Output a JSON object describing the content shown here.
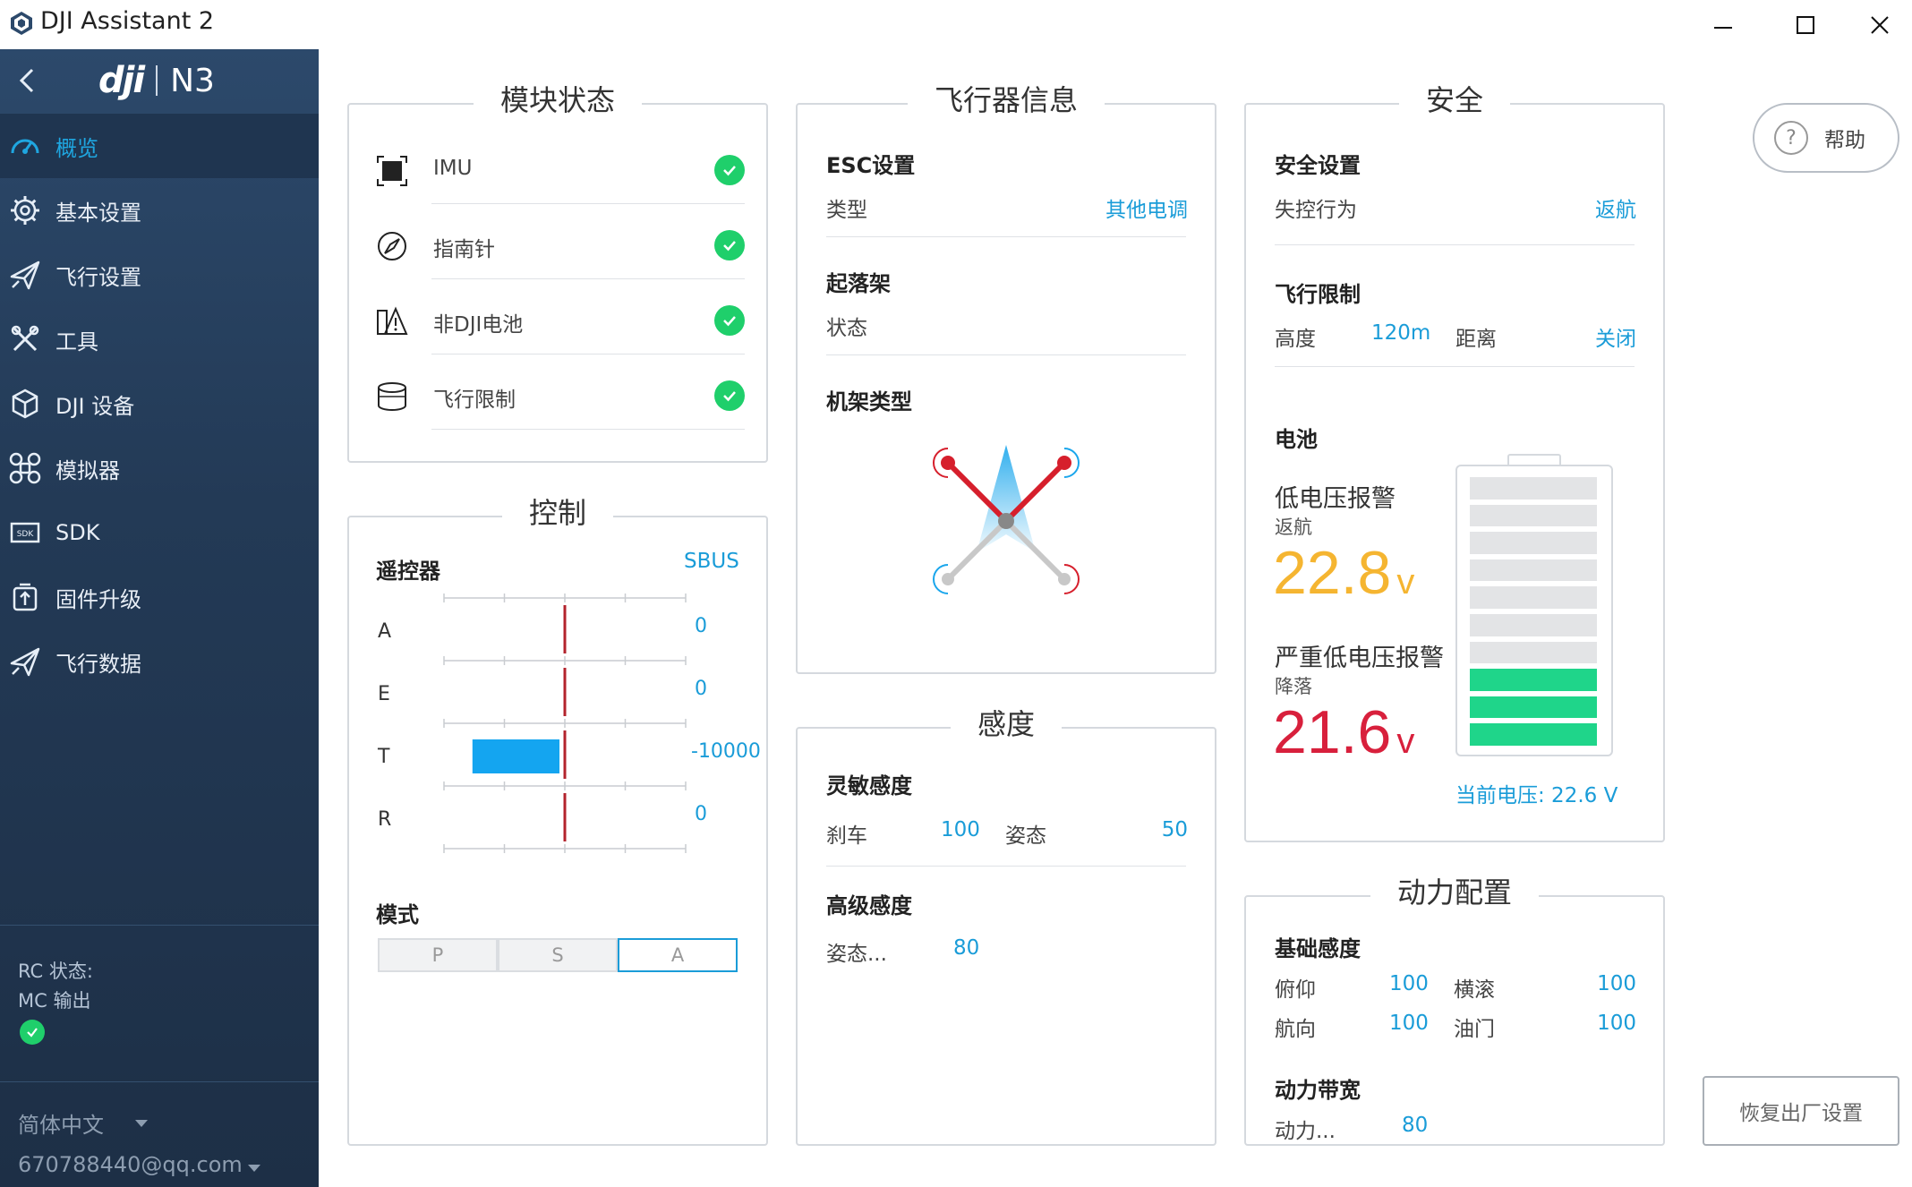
{
  "window": {
    "title": "DJI Assistant 2"
  },
  "sidebar": {
    "logo_brand": "dji",
    "model": "N3",
    "items": [
      {
        "label": "概览",
        "icon": "gauge-icon",
        "active": true
      },
      {
        "label": "基本设置",
        "icon": "gear-icon"
      },
      {
        "label": "飞行设置",
        "icon": "plane-icon"
      },
      {
        "label": "工具",
        "icon": "tools-icon"
      },
      {
        "label": "DJI 设备",
        "icon": "cube-icon"
      },
      {
        "label": "模拟器",
        "icon": "drone-icon"
      },
      {
        "label": "SDK",
        "icon": "sdk-icon"
      },
      {
        "label": "固件升级",
        "icon": "firmware-icon"
      },
      {
        "label": "飞行数据",
        "icon": "plane-data-icon"
      }
    ],
    "status": {
      "rc": "RC 状态:",
      "mc": "MC 输出"
    },
    "language": "简体中文",
    "account": "670788440@qq.com"
  },
  "module_status": {
    "title": "模块状态",
    "items": [
      {
        "label": "IMU",
        "icon": "imu-icon",
        "ok": true
      },
      {
        "label": "指南针",
        "icon": "compass-icon",
        "ok": true
      },
      {
        "label": "非DJI电池",
        "icon": "battery-warning-icon",
        "ok": true
      },
      {
        "label": "飞行限制",
        "icon": "flight-limit-icon",
        "ok": true
      }
    ]
  },
  "control": {
    "title": "控制",
    "rc_label": "遥控器",
    "rc_type": "SBUS",
    "channels": [
      {
        "name": "A",
        "value": "0",
        "fraction": 0
      },
      {
        "name": "E",
        "value": "0",
        "fraction": 0
      },
      {
        "name": "T",
        "value": "-10000",
        "fraction": -1
      },
      {
        "name": "R",
        "value": "0",
        "fraction": 0
      }
    ],
    "mode_label": "模式",
    "modes": [
      "P",
      "S",
      "A"
    ],
    "selected_mode": "A"
  },
  "aircraft_info": {
    "title": "飞行器信息",
    "esc_header": "ESC设置",
    "esc_type_label": "类型",
    "esc_type_value": "其他电调",
    "landing_gear_header": "起落架",
    "landing_gear_status": "状态",
    "frame_header": "机架类型"
  },
  "sensitivity": {
    "title": "感度",
    "basic_header": "灵敏感度",
    "brake_label": "刹车",
    "brake_value": "100",
    "attitude_label": "姿态",
    "attitude_value": "50",
    "advanced_header": "高级感度",
    "adv_attitude_label": "姿态...",
    "adv_attitude_value": "80"
  },
  "safety": {
    "title": "安全",
    "settings_header": "安全设置",
    "failsafe_label": "失控行为",
    "failsafe_value": "返航",
    "flight_limit_header": "飞行限制",
    "height_label": "高度",
    "height_value": "120m",
    "distance_label": "距离",
    "distance_value": "关闭",
    "battery_header": "电池",
    "low_voltage_label": "低电压报警",
    "low_voltage_action": "返航",
    "low_voltage_value": "22.8",
    "critical_voltage_label": "严重低电压报警",
    "critical_voltage_action": "降落",
    "critical_voltage_value": "21.6",
    "unit": "v",
    "current_voltage": "当前电压: 22.6 V",
    "battery_level_fraction": 0.3,
    "colors": {
      "low": "#f5b531",
      "critical": "#d8203c",
      "cell_on": "#1fd58a",
      "cell_off": "#e3e4e6"
    }
  },
  "power": {
    "title": "动力配置",
    "basic_header": "基础感度",
    "pitch_label": "俯仰",
    "pitch_value": "100",
    "roll_label": "横滚",
    "roll_value": "100",
    "yaw_label": "航向",
    "yaw_value": "100",
    "throttle_label": "油门",
    "throttle_value": "100",
    "bandwidth_header": "动力带宽",
    "bandwidth_label": "动力...",
    "bandwidth_value": "80"
  },
  "help_label": "帮助",
  "reset_label": "恢复出厂设置",
  "accent": "#1a9cd8"
}
